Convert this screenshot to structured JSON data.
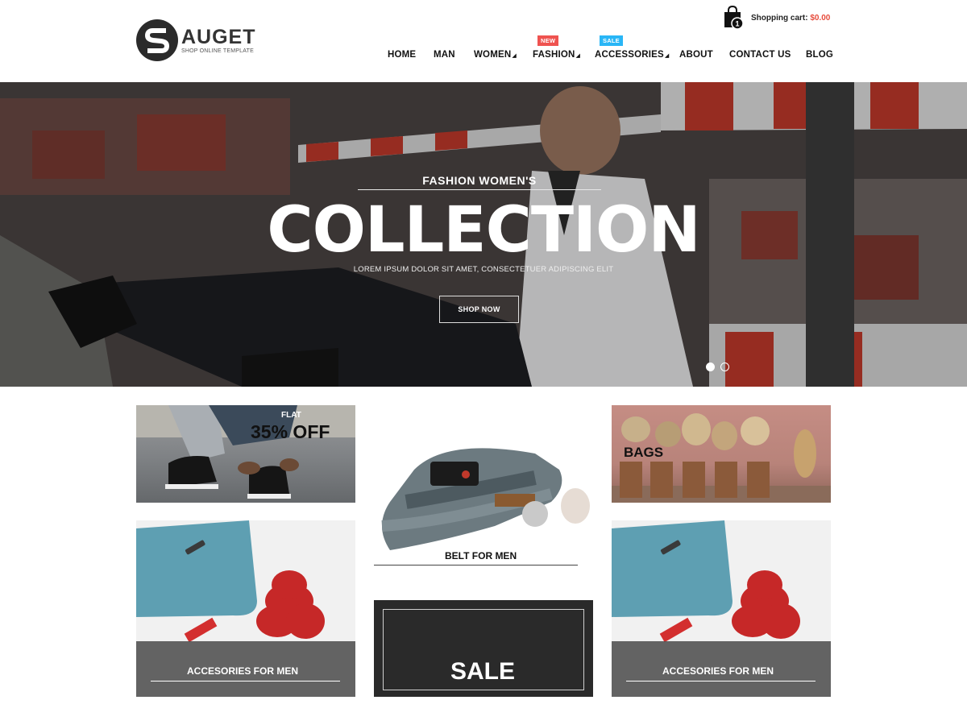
{
  "brand": {
    "name": "AUGET",
    "tagline": "SHOP ONLINE TEMPLATE"
  },
  "cart": {
    "count": "1",
    "label": "Shopping cart:",
    "amount": "$0.00"
  },
  "nav": {
    "items": [
      {
        "label": "HOME"
      },
      {
        "label": "MAN"
      },
      {
        "label": "WOMEN"
      },
      {
        "label": "FASHION",
        "badge": "NEW"
      },
      {
        "label": "ACCESSORIES",
        "badge": "SALE"
      },
      {
        "label": "ABOUT"
      },
      {
        "label": "CONTACT US"
      },
      {
        "label": "BLOG"
      }
    ]
  },
  "hero": {
    "subtitle": "FASHION WOMEN'S",
    "title": "COLLECTION",
    "description": "LOREM IPSUM DOLOR SIT AMET, CONSECTETUER ADIPISCING ELIT",
    "button": "SHOP NOW",
    "slides": 2,
    "active_slide": 1
  },
  "promos": {
    "shoes": {
      "small": "FLAT",
      "big": "35% OFF"
    },
    "belt": {
      "label": "BELT FOR MEN"
    },
    "bags": {
      "label": "BAGS"
    },
    "accessories_left": {
      "label": "ACCESORIES FOR MEN"
    },
    "sale": {
      "label": "SALE"
    },
    "accessories_right": {
      "label": "ACCESORIES FOR MEN"
    }
  },
  "colors": {
    "accent_red": "#e74c3c",
    "badge_new": "#ef5350",
    "badge_sale": "#29b6f6",
    "dark": "#2a2a2a"
  }
}
